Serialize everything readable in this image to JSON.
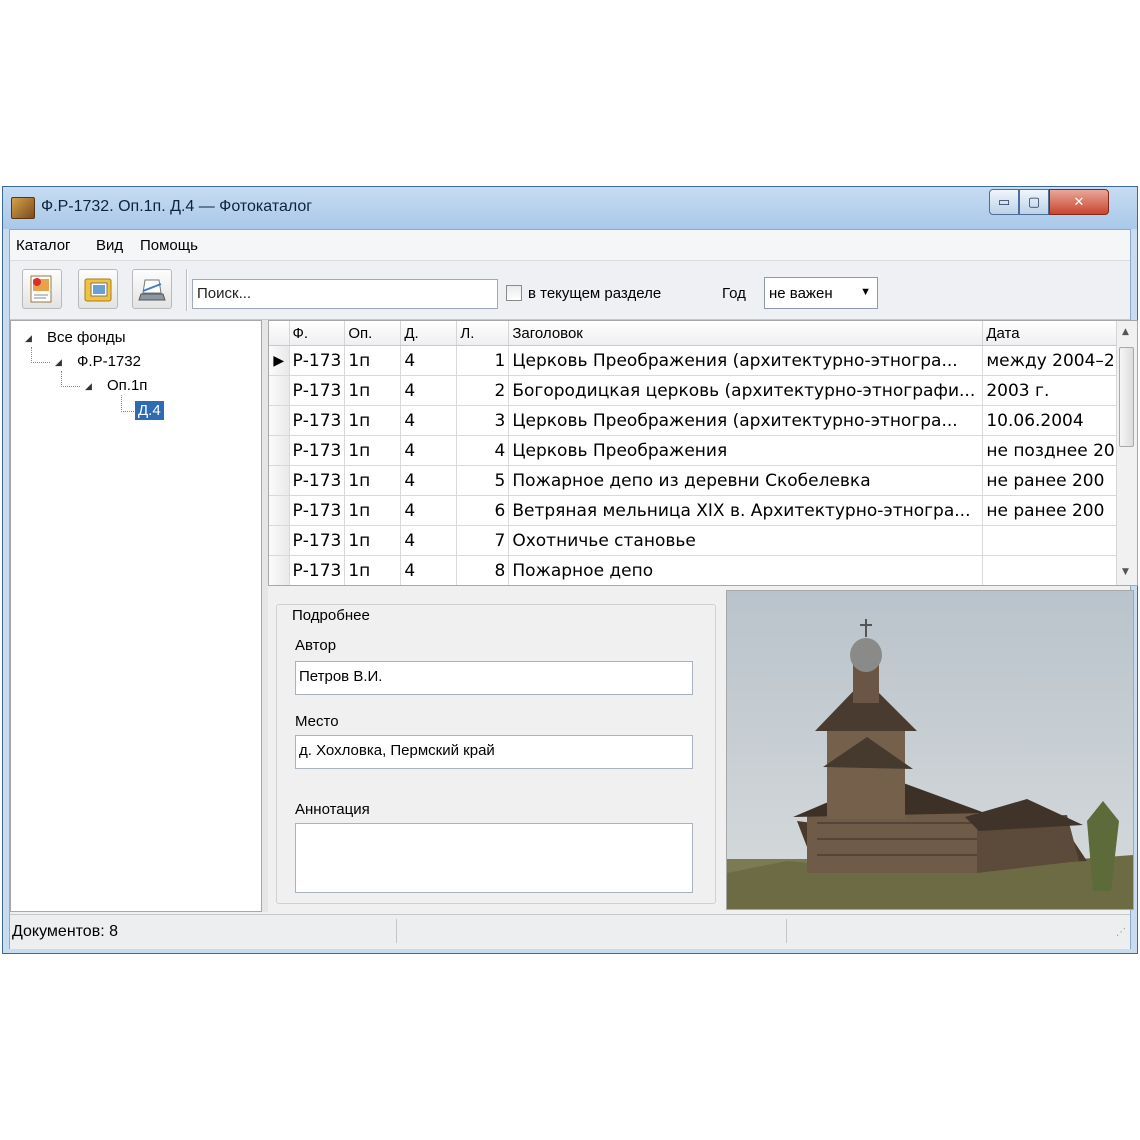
{
  "window": {
    "title": "Ф.Р-1732. Оп.1п. Д.4 — Фотокаталог",
    "minimize": "▭",
    "maximize": "▢",
    "close": "✕"
  },
  "menu": [
    "Каталог",
    "Вид",
    "Помощь"
  ],
  "toolbar": {
    "buttons": [
      "new-record-icon",
      "open-folder-icon",
      "scan-icon"
    ],
    "search_value": "Поиск...",
    "checkbox_label": "в текущем разделе",
    "checkbox_checked": false,
    "year_label": "Год",
    "year_value": "не важен"
  },
  "tree": {
    "root": "Все фонды",
    "fond": "Ф.Р-1732",
    "opis": "Оп.1п",
    "delo": "Д.4",
    "selected": "Д.4"
  },
  "grid": {
    "columns": [
      "Ф.",
      "Оп.",
      "Д.",
      "Л.",
      "Заголовок",
      "Дата"
    ],
    "rows": [
      {
        "f": "Р-173",
        "op": "1п",
        "d": "4",
        "l": "1",
        "title": "Церковь Преображения (архитектурно-этногра...",
        "date": "между 2004–2"
      },
      {
        "f": "Р-173",
        "op": "1п",
        "d": "4",
        "l": "2",
        "title": "Богородицкая церковь (архитектурно-этнографи...",
        "date": "2003 г."
      },
      {
        "f": "Р-173",
        "op": "1п",
        "d": "4",
        "l": "3",
        "title": "Церковь Преображения (архитектурно-этногра...",
        "date": "10.06.2004"
      },
      {
        "f": "Р-173",
        "op": "1п",
        "d": "4",
        "l": "4",
        "title": "Церковь Преображения",
        "date": "не позднее 20"
      },
      {
        "f": "Р-173",
        "op": "1п",
        "d": "4",
        "l": "5",
        "title": "Пожарное депо из деревни Скобелевка",
        "date": "не ранее 200"
      },
      {
        "f": "Р-173",
        "op": "1п",
        "d": "4",
        "l": "6",
        "title": "Ветряная мельница XIX в. Архитектурно-этногра...",
        "date": "не ранее 200"
      },
      {
        "f": "Р-173",
        "op": "1п",
        "d": "4",
        "l": "7",
        "title": "Охотничье становье",
        "date": ""
      },
      {
        "f": "Р-173",
        "op": "1п",
        "d": "4",
        "l": "8",
        "title": "Пожарное депо",
        "date": ""
      }
    ],
    "current_row_marker": "▶"
  },
  "details": {
    "group_title": "Подробнее",
    "author_label": "Автор",
    "author_value": "Петров В.И.",
    "place_label": "Место",
    "place_value": "д. Хохловка, Пермский край",
    "annotation_label": "Аннотация",
    "annotation_value": ""
  },
  "status": {
    "documents": "Документов: 8"
  },
  "colors": {
    "selection": "#2f6bb3",
    "title_bar": "#c7dcf3",
    "close_button": "#c9452e"
  }
}
